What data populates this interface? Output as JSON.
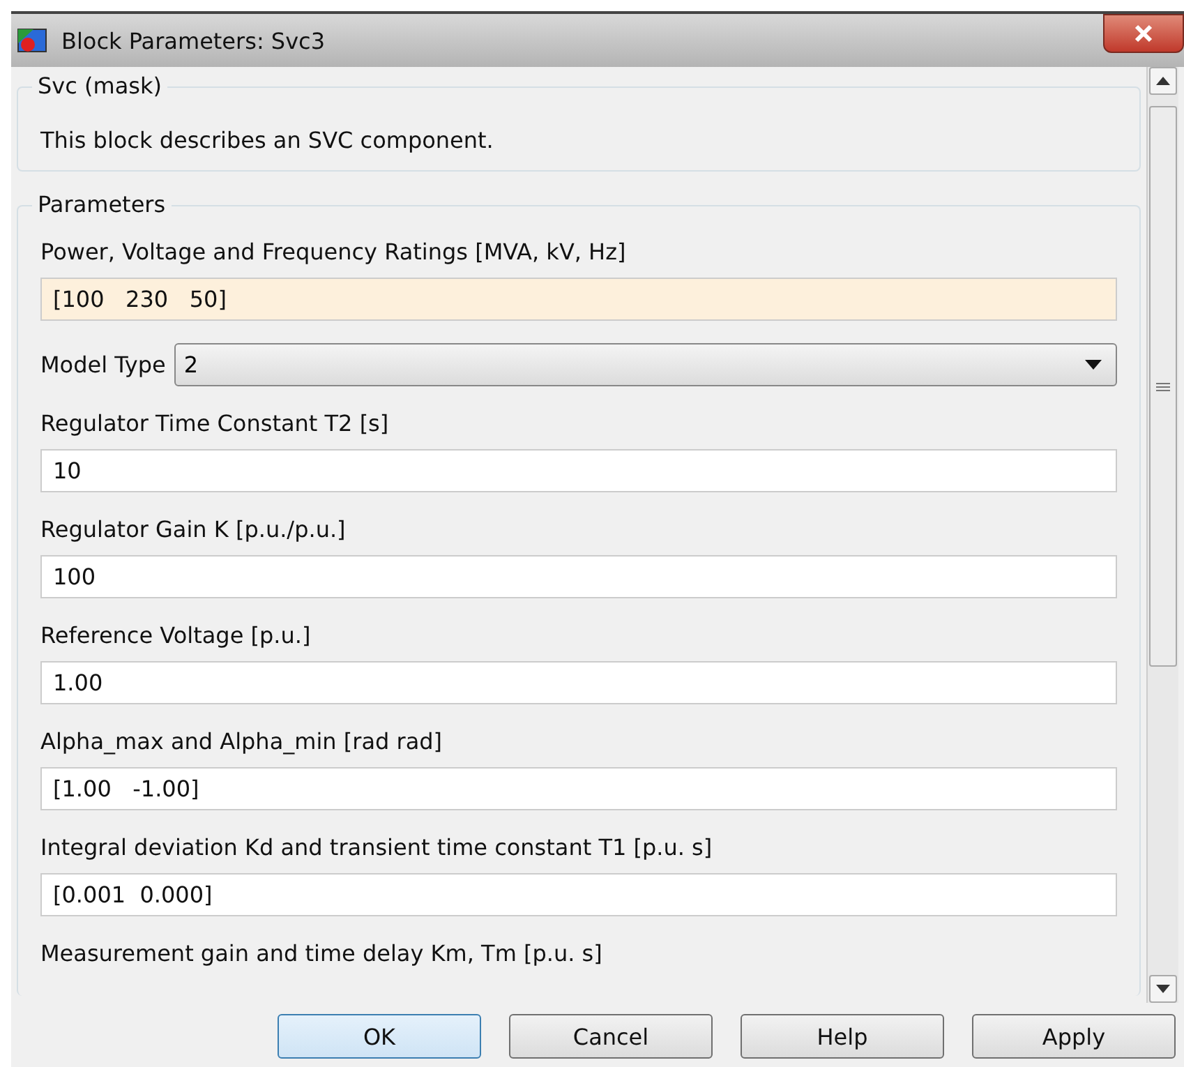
{
  "window": {
    "title": "Block Parameters: Svc3"
  },
  "mask": {
    "title": "Svc (mask)",
    "description": "This block describes an SVC component."
  },
  "parameters": {
    "title": "Parameters",
    "items": [
      {
        "kind": "edit",
        "label": "Power, Voltage and Frequency Ratings [MVA, kV, Hz]",
        "value": "[100   230   50]",
        "focused": true
      },
      {
        "kind": "popup",
        "label": "Model Type",
        "value": "2"
      },
      {
        "kind": "edit",
        "label": "Regulator Time Constant T2 [s]",
        "value": "10",
        "focused": false
      },
      {
        "kind": "edit",
        "label": "Regulator Gain K [p.u./p.u.]",
        "value": "100",
        "focused": false
      },
      {
        "kind": "edit",
        "label": "Reference Voltage [p.u.]",
        "value": "1.00",
        "focused": false
      },
      {
        "kind": "edit",
        "label": "Alpha_max and Alpha_min [rad rad]",
        "value": "[1.00   -1.00]",
        "focused": false
      },
      {
        "kind": "edit",
        "label": "Integral deviation Kd and transient time constant T1 [p.u. s]",
        "value": "[0.001  0.000]",
        "focused": false
      },
      {
        "kind": "label",
        "label": "Measurement gain and time delay Km, Tm [p.u. s]"
      }
    ]
  },
  "buttons": [
    {
      "label": "OK",
      "default": true
    },
    {
      "label": "Cancel",
      "default": false
    },
    {
      "label": "Help",
      "default": false
    },
    {
      "label": "Apply",
      "default": false
    }
  ]
}
